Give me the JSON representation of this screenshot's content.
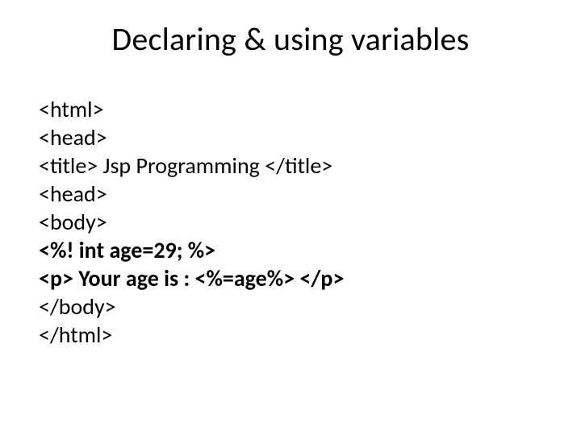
{
  "title": "Declaring & using variables",
  "lines": [
    {
      "text": "<html>",
      "bold": false
    },
    {
      "text": "<head>",
      "bold": false
    },
    {
      "text": "<title> Jsp Programming </title>",
      "bold": false
    },
    {
      "text": "<head>",
      "bold": false
    },
    {
      "text": "<body>",
      "bold": false
    },
    {
      "text": "<%! int age=29; %>",
      "bold": true
    },
    {
      "text": "<p> Your age is : <%=age%> </p>",
      "bold": true
    },
    {
      "text": "</body>",
      "bold": false
    },
    {
      "text": "</html>",
      "bold": false
    }
  ]
}
